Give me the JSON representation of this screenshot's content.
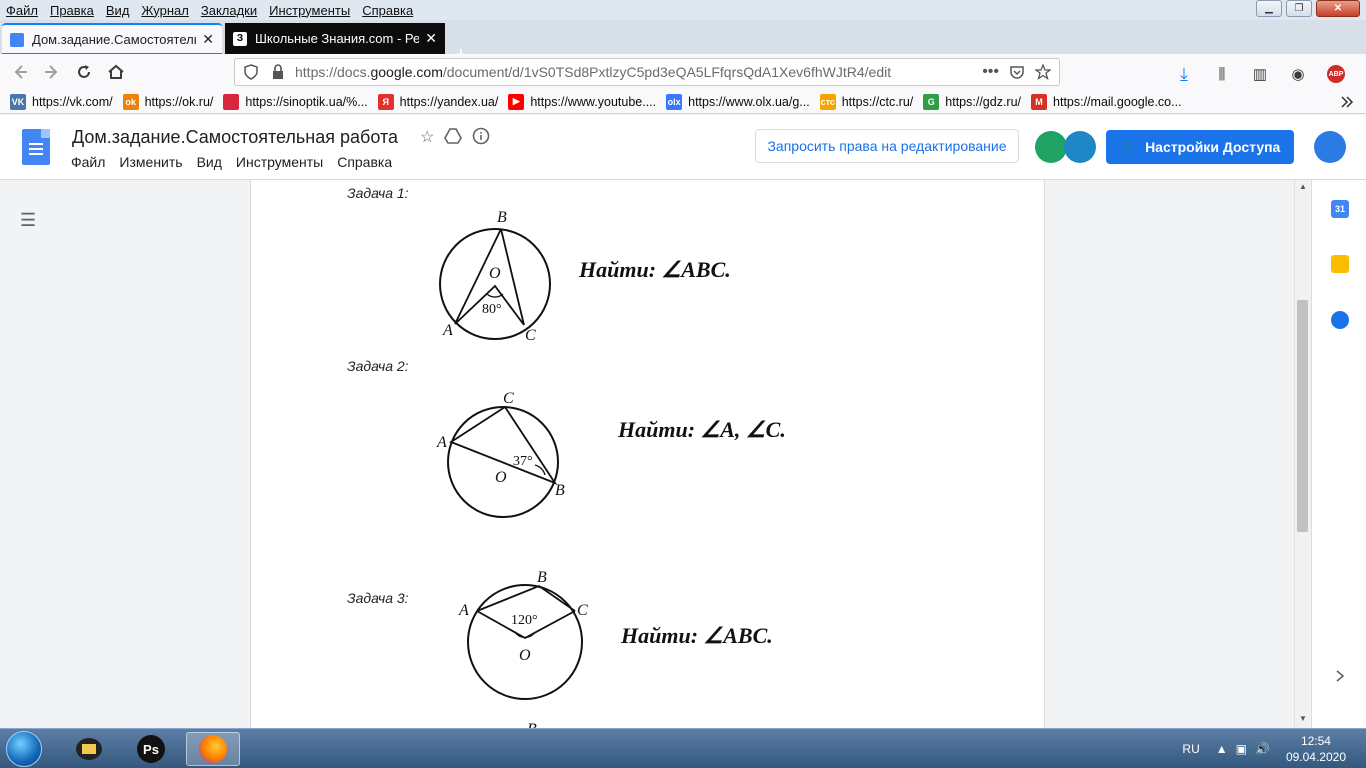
{
  "firefox": {
    "menu": [
      "Файл",
      "Правка",
      "Вид",
      "Журнал",
      "Закладки",
      "Инструменты",
      "Справка"
    ],
    "tabs": [
      {
        "title": "Дом.задание.Самостоятельна",
        "favicon": "google-docs-icon",
        "active": true
      },
      {
        "title": "Школьные Знания.com - Реш",
        "favicon_text": "З",
        "favicon": "znanija-icon",
        "active": false
      }
    ],
    "new_tab": "+",
    "url_prefix": "https://docs.",
    "url_domain": "google.com",
    "url_rest": "/document/d/1vS0TSd8PxtlzyC5pd3eQA5LFfqrsQdA1Xev6fhWJtR4/edit",
    "bookmarks": [
      {
        "label": "https://vk.com/",
        "icon": "vk-icon",
        "icon_text": "VK",
        "color": "#4a76a8"
      },
      {
        "label": "https://ok.ru/",
        "icon": "ok-icon",
        "icon_text": "ok",
        "color": "#ee8208"
      },
      {
        "label": "https://sinoptik.ua/%...",
        "icon": "thermometer-icon",
        "icon_text": "",
        "color": "#d7263d"
      },
      {
        "label": "https://yandex.ua/",
        "icon": "yandex-icon",
        "icon_text": "Я",
        "color": "#e0312d"
      },
      {
        "label": "https://www.youtube....",
        "icon": "youtube-icon",
        "icon_text": "▶",
        "color": "#ff0000"
      },
      {
        "label": "https://www.olx.ua/g...",
        "icon": "olx-icon",
        "icon_text": "olx",
        "color": "#3a77ff"
      },
      {
        "label": "https://ctc.ru/",
        "icon": "ctc-icon",
        "icon_text": "стс",
        "color": "#f5a300"
      },
      {
        "label": "https://gdz.ru/",
        "icon": "gdz-icon",
        "icon_text": "G",
        "color": "#2f9e44"
      },
      {
        "label": "https://mail.google.co...",
        "icon": "gmail-icon",
        "icon_text": "M",
        "color": "#d93025"
      }
    ]
  },
  "docs": {
    "title": "Дом.задание.Самостоятельная работа",
    "menu": [
      "Файл",
      "Изменить",
      "Вид",
      "Инструменты",
      "Справка"
    ],
    "request_edit": "Запросить права на редактирование",
    "share": "Настройки Доступа",
    "calendar_day": "31"
  },
  "document": {
    "tasks": [
      {
        "label": "Задача 1:",
        "find": "Найти: ∠ABC.",
        "points": [
          "B",
          "O",
          "A",
          "C"
        ],
        "angle": "80°"
      },
      {
        "label": "Задача 2:",
        "find": "Найти: ∠A, ∠C.",
        "points": [
          "C",
          "A",
          "O",
          "B"
        ],
        "angle": "37°"
      },
      {
        "label": "Задача 3:",
        "find": "Найти: ∠ABC.",
        "points": [
          "B",
          "A",
          "C",
          "O"
        ],
        "angle": "120°"
      }
    ],
    "next_point": "B"
  },
  "taskbar": {
    "lang": "RU",
    "time": "12:54",
    "date": "09.04.2020"
  }
}
